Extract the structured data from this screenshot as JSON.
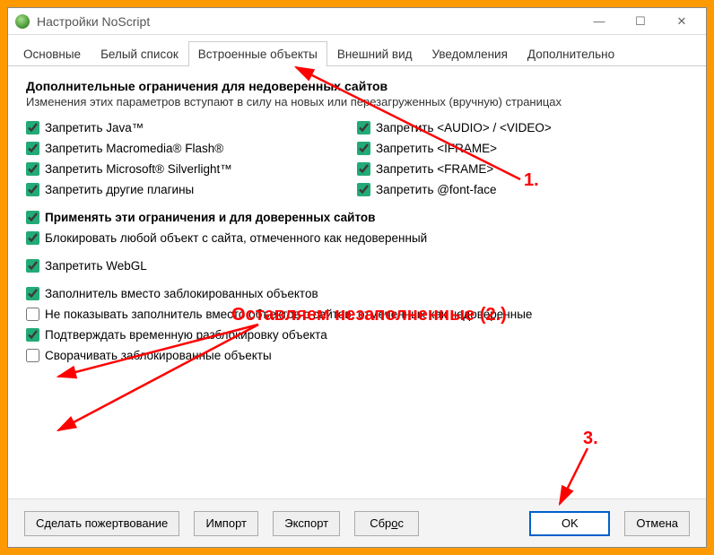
{
  "window": {
    "title": "Настройки NoScript"
  },
  "tabs": {
    "t0": "Основные",
    "t1": "Белый список",
    "t2": "Встроенные объекты",
    "t3": "Внешний вид",
    "t4": "Уведомления",
    "t5": "Дополнительно"
  },
  "section": {
    "title": "Дополнительные ограничения для недоверенных сайтов",
    "sub": "Изменения этих параметров вступают в силу на новых или перезагруженных (вручную) страницах"
  },
  "checks": {
    "java": {
      "label": "Запретить Java™",
      "on": true
    },
    "flash": {
      "label": "Запретить Macromedia® Flash®",
      "on": true
    },
    "silverlight": {
      "label": "Запретить Microsoft® Silverlight™",
      "on": true
    },
    "plugins": {
      "label": "Запретить другие плагины",
      "on": true
    },
    "audio": {
      "label": "Запретить <AUDIO> / <VIDEO>",
      "on": true
    },
    "iframe": {
      "label": "Запретить <IFRAME>",
      "on": true
    },
    "frame": {
      "label": "Запретить <FRAME>",
      "on": true
    },
    "font": {
      "label": "Запретить @font-face",
      "on": true
    },
    "trusted": {
      "label": "Применять эти ограничения и для доверенных сайтов",
      "on": true
    },
    "blockany": {
      "label": "Блокировать любой объект с сайта, отмеченного как недоверенный",
      "on": true
    },
    "webgl": {
      "label": "Запретить WebGL",
      "on": true
    },
    "placeholder": {
      "label": "Заполнитель вместо заблокированных объектов",
      "on": true
    },
    "hideuntrust": {
      "label": "Не показывать заполнитель вместо объектов с сайтов, отмеченных как недоверенные",
      "on": false
    },
    "confirm": {
      "label": "Подтверждать временную разблокировку объекта",
      "on": true
    },
    "collapse": {
      "label": "Сворачивать заблокированные объекты",
      "on": false
    }
  },
  "buttons": {
    "donate": "Сделать пожертвование",
    "import": "Импорт",
    "export": "Экспорт",
    "reset": "Сброс",
    "ok": "OK",
    "cancel": "Отмена"
  },
  "annotations": {
    "n1": "1.",
    "n2": "Оставляем незаполненные (2.)",
    "n3": "3."
  }
}
